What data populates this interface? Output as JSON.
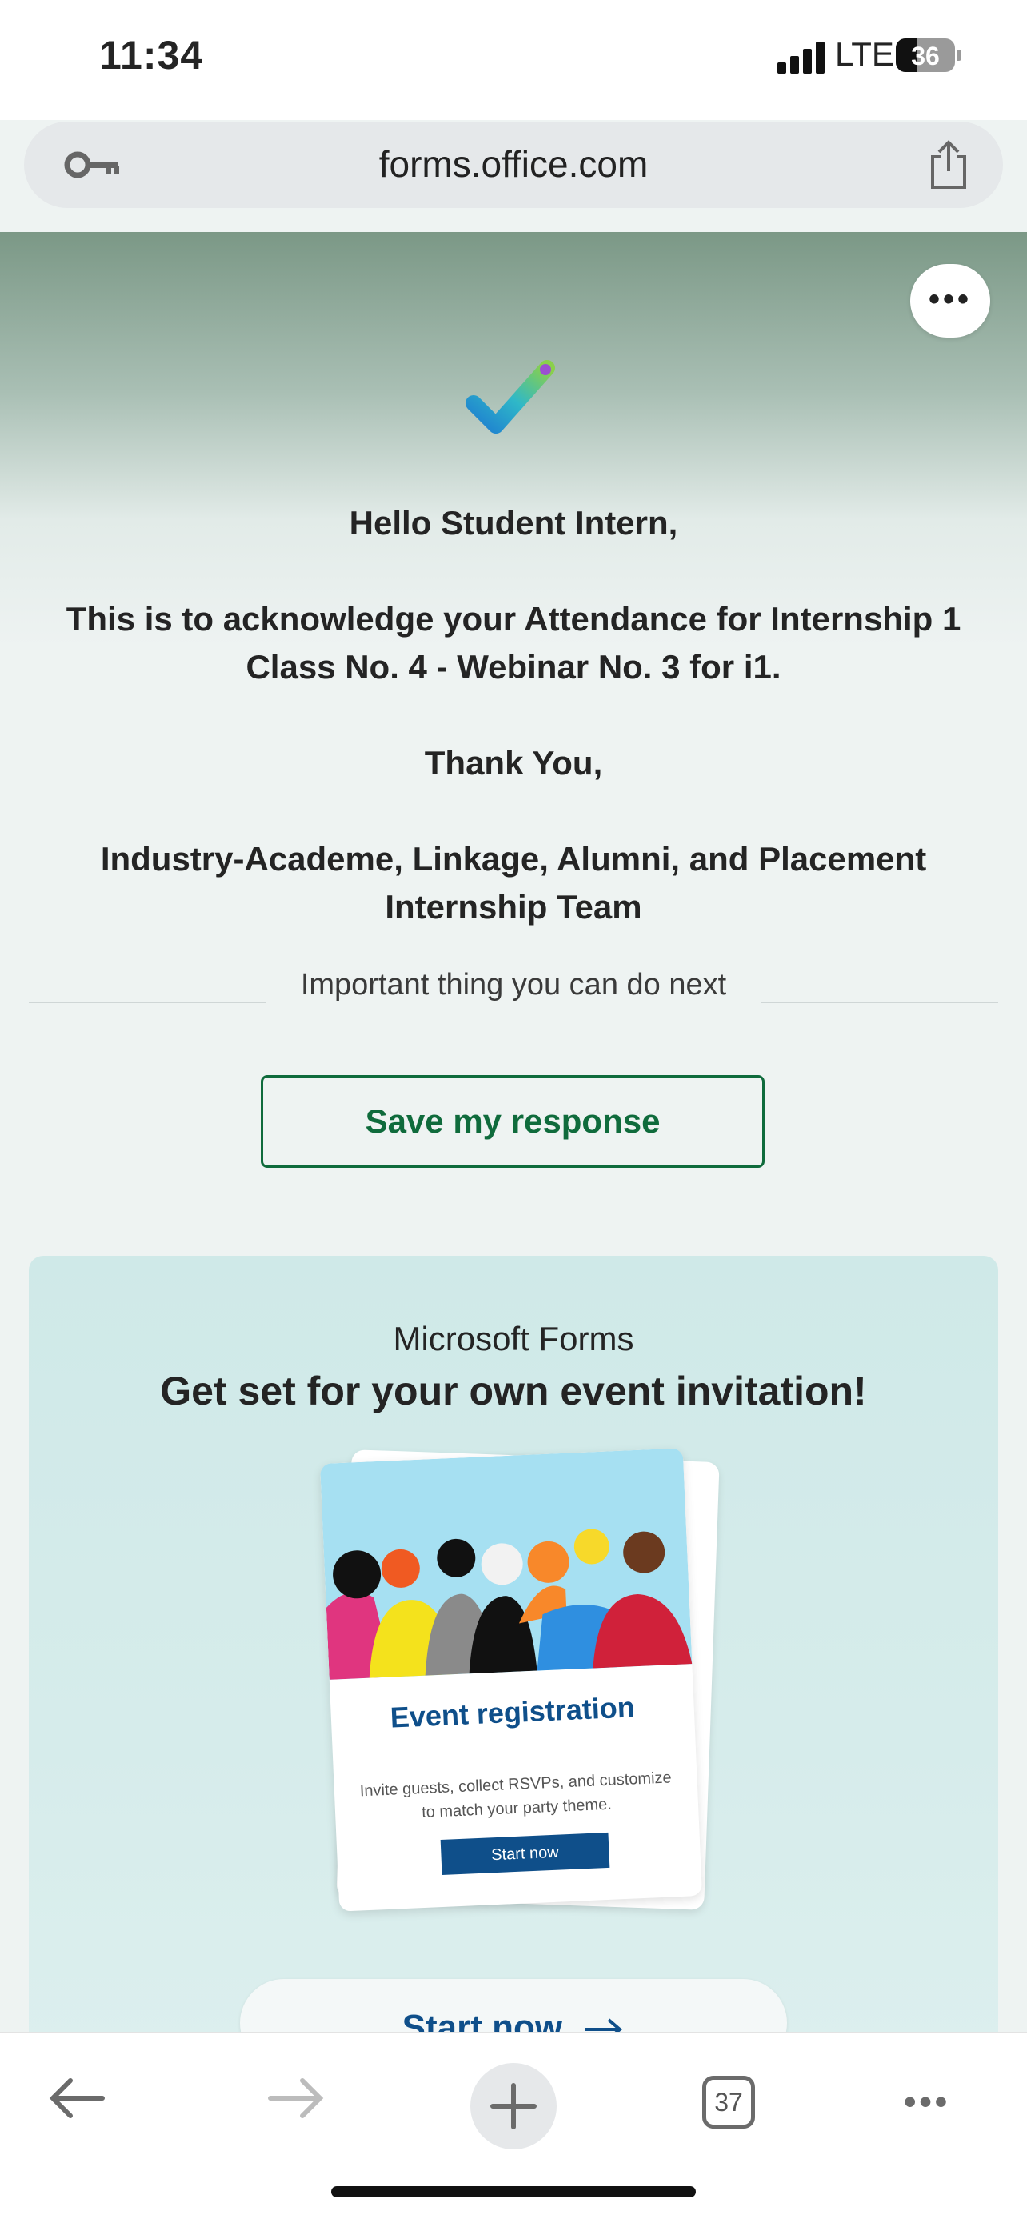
{
  "status_bar": {
    "time": "11:34",
    "network": "LTE",
    "battery_percent": "36",
    "battery_level": 0.36
  },
  "browser": {
    "url": "forms.office.com",
    "tab_count": "37"
  },
  "confirmation": {
    "greeting": "Hello Student Intern,",
    "body_line1": "This is to acknowledge your Attendance for Internship 1",
    "body_line2": "Class No. 4 -  Webinar No. 3 for i1.",
    "thanks": "Thank You,",
    "team_line1": "Industry-Academe, Linkage, Alumni, and Placement",
    "team_line2": "Internship Team"
  },
  "next_steps": {
    "divider_label": "Important thing you can do next",
    "save_button": "Save my response"
  },
  "promo": {
    "brand": "Microsoft Forms",
    "title": "Get set for your own event invitation!",
    "card_title": "Event registration",
    "card_desc_line1": "Invite guests, collect RSVPs, and customize",
    "card_desc_line2": "to match your party theme.",
    "card_button": "Start now",
    "start_button": "Start now"
  },
  "icons": [
    "key-icon",
    "share-icon",
    "more-icon",
    "checkmark-icon",
    "arrow-right-icon",
    "back-icon",
    "forward-icon",
    "plus-icon",
    "tabs-icon"
  ],
  "colors": {
    "accent_green": "#0f6b3c",
    "forms_blue": "#0f4f8a",
    "header_green": "#7b9886"
  }
}
